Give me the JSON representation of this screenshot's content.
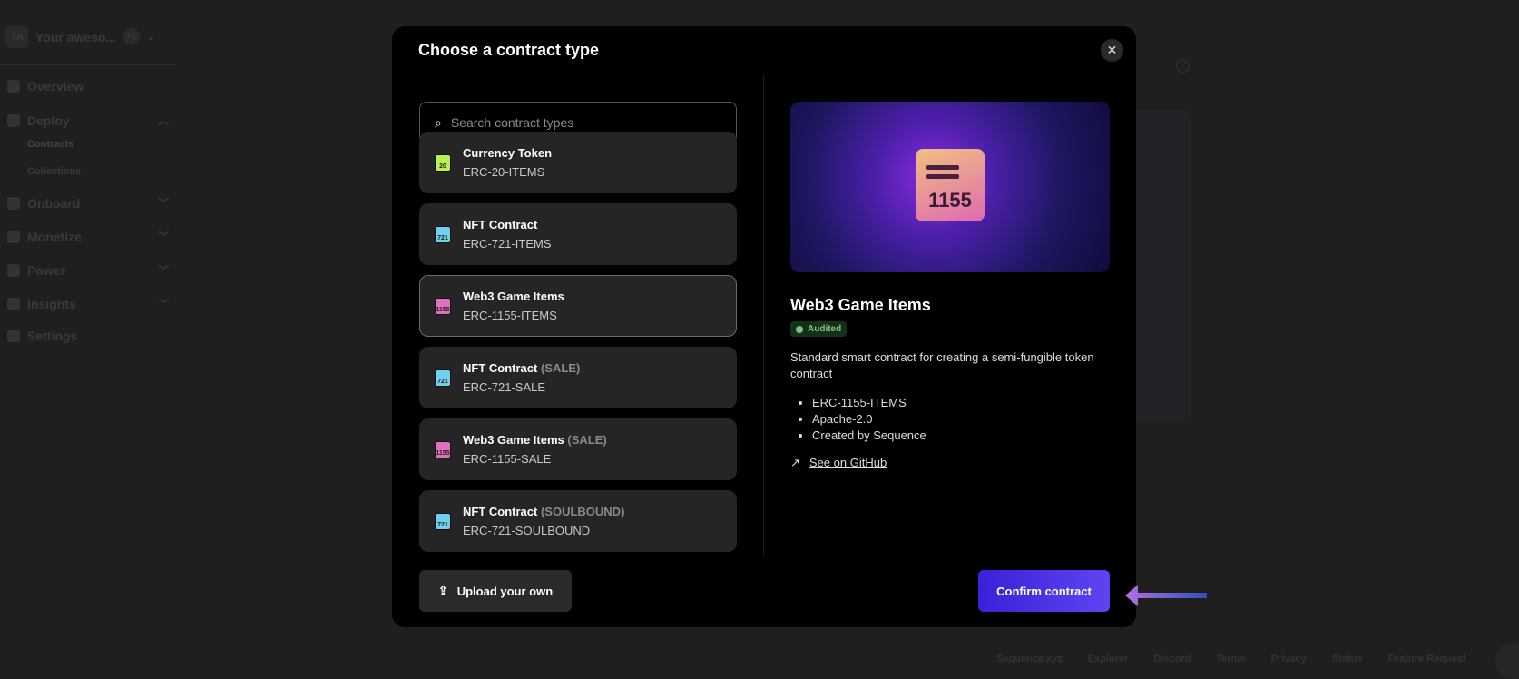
{
  "sidebar": {
    "org_initials": "YA",
    "org_name": "Your aweso...",
    "member_extra": "+1",
    "items": [
      {
        "label": "Overview",
        "icon": "home-icon"
      },
      {
        "label": "Deploy",
        "icon": "cubes-icon"
      },
      {
        "label": "Onboard",
        "icon": "parachute-icon"
      },
      {
        "label": "Monetize",
        "icon": "coins-icon"
      },
      {
        "label": "Power",
        "icon": "hammer-icon"
      },
      {
        "label": "Insights",
        "icon": "users-icon"
      },
      {
        "label": "Settings",
        "icon": "gear-icon"
      }
    ],
    "deploy_sub": [
      "Contracts",
      "Collections"
    ]
  },
  "footer": {
    "links": [
      "Sequence.xyz",
      "Explorer",
      "Discord",
      "Terms",
      "Privacy",
      "Status",
      "Feature Request"
    ]
  },
  "modal": {
    "title": "Choose a contract type",
    "search_placeholder": "Search contract types",
    "items": [
      {
        "name": "Currency Token",
        "tag": "",
        "sub": "ERC-20-ITEMS",
        "icon_text": "20",
        "color": "#b8f050"
      },
      {
        "name": "NFT Contract",
        "tag": "",
        "sub": "ERC-721-ITEMS",
        "icon_text": "721",
        "color": "#70d0f0"
      },
      {
        "name": "Web3 Game Items",
        "tag": "",
        "sub": "ERC-1155-ITEMS",
        "icon_text": "1155",
        "color": "#e070c0",
        "selected": true
      },
      {
        "name": "NFT Contract",
        "tag": "(SALE)",
        "sub": "ERC-721-SALE",
        "icon_text": "721",
        "color": "#70d0f0"
      },
      {
        "name": "Web3 Game Items",
        "tag": "(SALE)",
        "sub": "ERC-1155-SALE",
        "icon_text": "1155",
        "color": "#e070c0"
      },
      {
        "name": "NFT Contract",
        "tag": "(SOULBOUND)",
        "sub": "ERC-721-SOULBOUND",
        "icon_text": "721",
        "color": "#70d0f0"
      }
    ],
    "detail": {
      "hero_text": "1155",
      "title": "Web3 Game Items",
      "badge": "Audited",
      "description": "Standard smart contract for creating a semi-fungible token contract",
      "bullets": [
        "ERC-1155-ITEMS",
        "Apache-2.0",
        "Created by Sequence"
      ],
      "github": "See on GitHub"
    },
    "upload_label": "Upload your own",
    "confirm_label": "Confirm contract"
  },
  "colors": {
    "accent": "#5e45f0",
    "arrow": "#a070e0"
  }
}
